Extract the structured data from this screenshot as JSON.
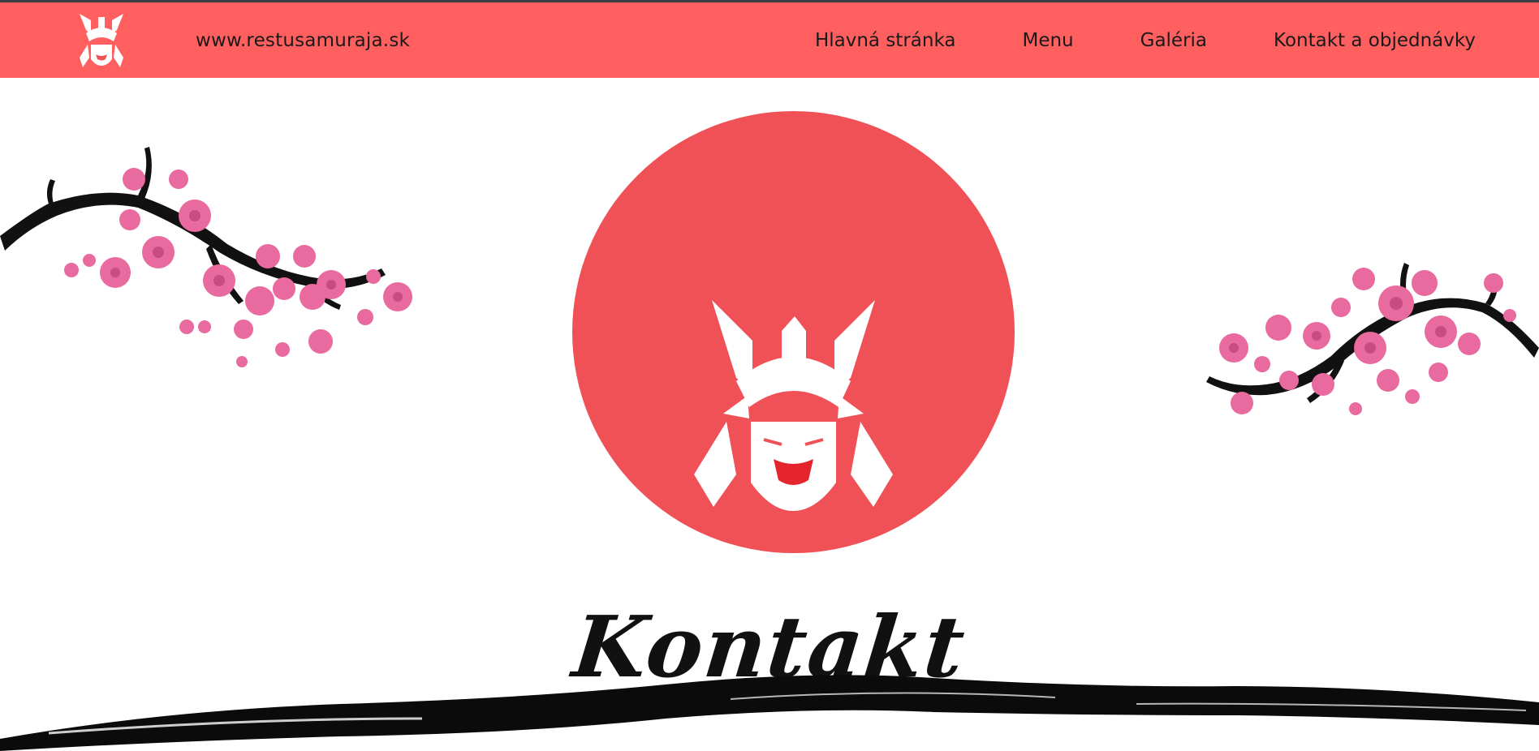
{
  "header": {
    "logo": {
      "icon": "samurai-mask-icon",
      "color": "#ffffff"
    },
    "site_url": "www.restusamuraja.sk",
    "nav": [
      {
        "label": "Hlavná stránka"
      },
      {
        "label": "Menu"
      },
      {
        "label": "Galéria"
      },
      {
        "label": "Kontakt a objednávky"
      }
    ],
    "background": "#ff5f5f"
  },
  "hero": {
    "title": "Kontakt",
    "emblem": {
      "icon": "samurai-mask-icon",
      "circle_color": "#f05157"
    },
    "decorations": [
      "cherry-blossom-branch-left",
      "cherry-blossom-branch-right",
      "ink-brush-stroke"
    ],
    "blossom_color": "#e86a9e"
  }
}
